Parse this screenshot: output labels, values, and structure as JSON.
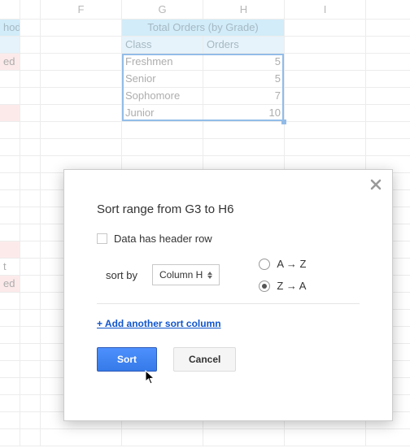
{
  "columns": {
    "d": "",
    "e": "",
    "f": "F",
    "g": "G",
    "h": "H",
    "i": "I"
  },
  "table": {
    "header": "Total Orders (by Grade)",
    "subhead": {
      "class": "Class",
      "orders": "Orders"
    },
    "rows": [
      {
        "class": "Freshmen",
        "orders": "5"
      },
      {
        "class": "Senior",
        "orders": "5"
      },
      {
        "class": "Sophomore",
        "orders": "7"
      },
      {
        "class": "Junior",
        "orders": "10"
      }
    ]
  },
  "fragments": {
    "row1d": "hod",
    "row3d": "ed",
    "row15d": "t",
    "row16d": "ed"
  },
  "dialog": {
    "title": "Sort range from G3 to H6",
    "header_checkbox": "Data has header row",
    "sort_by": "sort by",
    "column_select": "Column H",
    "radios": {
      "az": "A → Z",
      "za": "Z → A"
    },
    "add_link": "+ Add another sort column",
    "sort_btn": "Sort",
    "cancel_btn": "Cancel"
  }
}
